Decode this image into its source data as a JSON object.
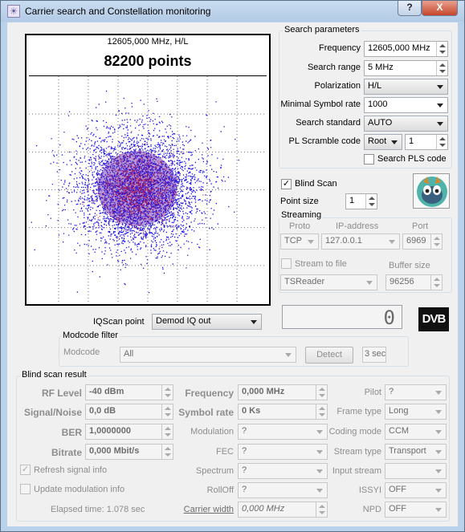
{
  "window": {
    "title": "Carrier search and Constellation monitoring",
    "help_label": "?",
    "close_label": "X"
  },
  "plot": {
    "subtitle": "12605,000 MHz, H/L",
    "points_label": "82200 points",
    "point_count": 82200
  },
  "search_params": {
    "title": "Search parameters",
    "frequency": {
      "label": "Frequency",
      "value": "12605,000 MHz"
    },
    "search_range": {
      "label": "Search range",
      "value": "5 MHz"
    },
    "polarization": {
      "label": "Polarization",
      "value": "H/L"
    },
    "min_symbol_rate": {
      "label": "Minimal Symbol rate",
      "value": "1000"
    },
    "search_standard": {
      "label": "Search standard",
      "value": "AUTO"
    },
    "pl_scramble": {
      "label": "PL Scramble code",
      "mode": "Root",
      "value": "1"
    },
    "search_pls": {
      "label": "Search PLS code",
      "checked": false
    }
  },
  "blind_scan": {
    "label": "Blind Scan",
    "checked": true,
    "check_mark": "✓"
  },
  "point_size": {
    "label": "Point size",
    "value": "1"
  },
  "streaming": {
    "title": "Streaming",
    "proto_header": "Proto",
    "ip_header": "IP-address",
    "port_header": "Port",
    "proto": "TCP",
    "ip": "127.0.0.1",
    "port": "6969",
    "stream_to_file": {
      "label": "Stream to file",
      "checked": false
    },
    "buffer_size": {
      "label": "Buffer size",
      "value": "96256"
    },
    "player": "TSReader"
  },
  "iqscan": {
    "label": "IQScan point",
    "value": "Demod IQ out"
  },
  "lcd_value": "0",
  "dvb_logo": "DVB",
  "modcode_filter": {
    "title": "Modcode filter",
    "label": "Modcode",
    "value": "All",
    "detect_label": "Detect",
    "interval": "3 sec"
  },
  "blind_result": {
    "title": "Blind scan result",
    "rf_level": {
      "label": "RF Level",
      "value": "-40 dBm"
    },
    "signal_noise": {
      "label": "Signal/Noise",
      "value": "0,0 dB"
    },
    "ber": {
      "label": "BER",
      "value": "1,0000000"
    },
    "bitrate": {
      "label": "Bitrate",
      "value": "0,000 Mbit/s"
    },
    "frequency": {
      "label": "Frequency",
      "value": "0,000 MHz"
    },
    "symbol_rate": {
      "label": "Symbol rate",
      "value": "0 Ks"
    },
    "modulation": {
      "label": "Modulation",
      "value": "?"
    },
    "fec": {
      "label": "FEC",
      "value": "?"
    },
    "spectrum": {
      "label": "Spectrum",
      "value": "?"
    },
    "rolloff": {
      "label": "RollOff",
      "value": "?"
    },
    "carrier_width": {
      "label": "Carrier width",
      "value": "0,000 MHz"
    },
    "pilot": {
      "label": "Pilot",
      "value": "?"
    },
    "frame_type": {
      "label": "Frame type",
      "value": "Long"
    },
    "coding_mode": {
      "label": "Coding mode",
      "value": "CCM"
    },
    "stream_type": {
      "label": "Stream type",
      "value": "Transport"
    },
    "input_stream": {
      "label": "Input stream",
      "value": ""
    },
    "issyi": {
      "label": "ISSYI",
      "value": "OFF"
    },
    "npd": {
      "label": "NPD",
      "value": "OFF"
    },
    "refresh_signal": {
      "label": "Refresh signal info",
      "checked": true,
      "check_mark": "✓"
    },
    "update_modulation": {
      "label": "Update modulation info",
      "checked": false
    },
    "elapsed": "Elapsed time: 1.078 sec"
  },
  "colors": {
    "accent_close": "#c6452c",
    "constellation_outer": "#1a10e8",
    "constellation_mid": "#5a1aa8",
    "constellation_core": "#c0143c"
  }
}
